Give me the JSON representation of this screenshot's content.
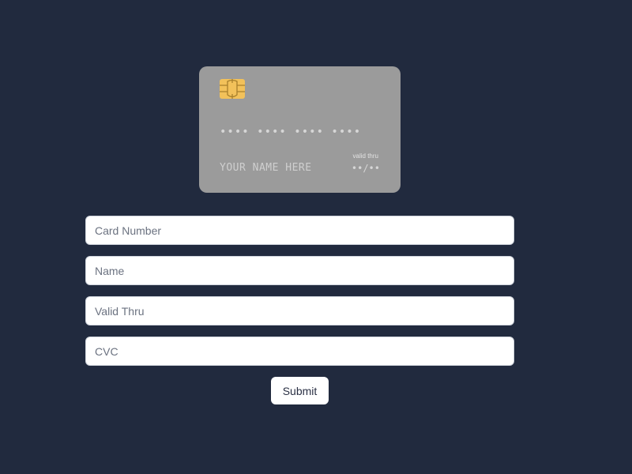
{
  "card": {
    "chip_icon": "sim-chip-icon",
    "number_mask": "•••• •••• •••• ••••",
    "name_placeholder": "YOUR NAME HERE",
    "valid_thru_label": "valid thru",
    "expiry_mask": "••/••",
    "background_color": "#9b9b9b"
  },
  "form": {
    "card_number": {
      "value": "",
      "placeholder": "Card Number"
    },
    "name": {
      "value": "",
      "placeholder": "Name"
    },
    "valid_thru": {
      "value": "",
      "placeholder": "Valid Thru"
    },
    "cvc": {
      "value": "",
      "placeholder": "CVC"
    },
    "submit_label": "Submit"
  },
  "colors": {
    "page_background": "#212a3e",
    "chip_gold": "#f2c15a"
  }
}
